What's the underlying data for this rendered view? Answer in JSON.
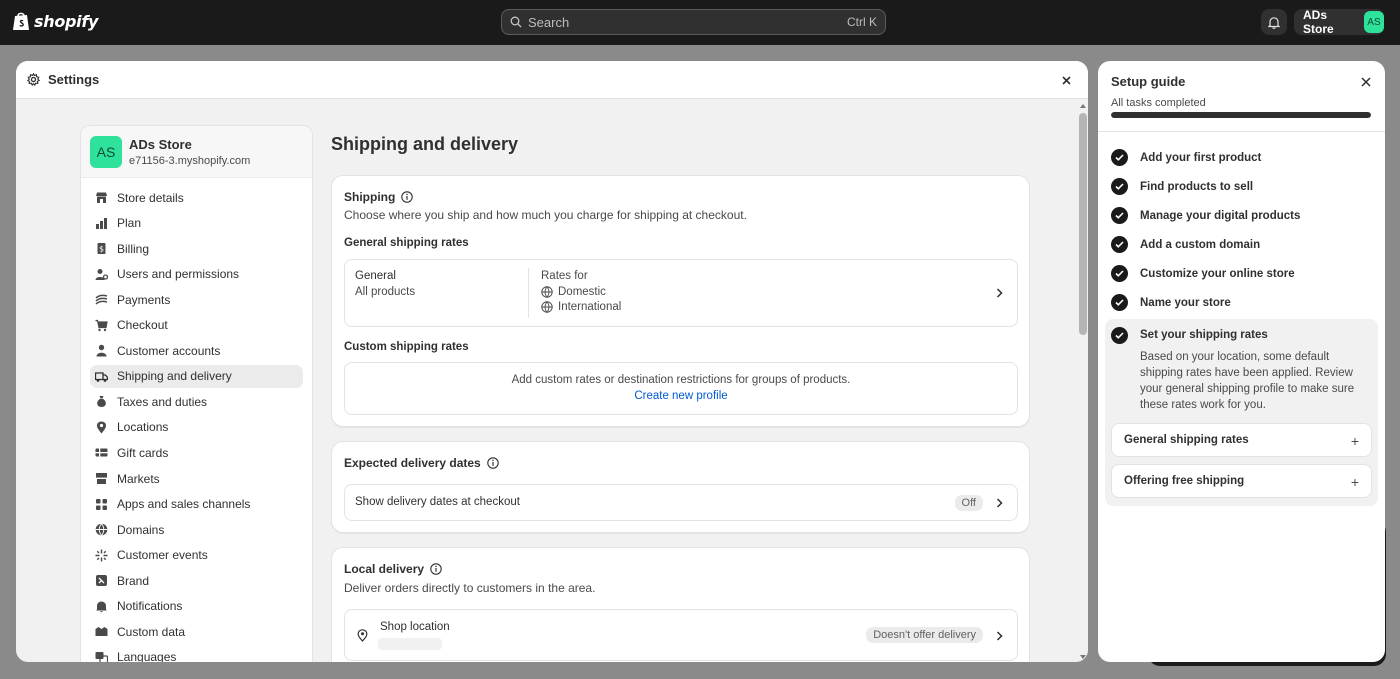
{
  "topbar": {
    "brand": "shopify",
    "search_placeholder": "Search",
    "search_shortcut": "Ctrl K",
    "store_label": "ADs Store",
    "store_initials": "AS"
  },
  "settings": {
    "title": "Settings",
    "store": {
      "initials": "AS",
      "name": "ADs Store",
      "domain": "e71156-3.myshopify.com"
    },
    "nav": [
      {
        "label": "Store details",
        "icon": "store-icon"
      },
      {
        "label": "Plan",
        "icon": "plan-chart-icon"
      },
      {
        "label": "Billing",
        "icon": "billing-icon"
      },
      {
        "label": "Users and permissions",
        "icon": "users-icon"
      },
      {
        "label": "Payments",
        "icon": "payments-icon"
      },
      {
        "label": "Checkout",
        "icon": "cart-icon"
      },
      {
        "label": "Customer accounts",
        "icon": "person-icon"
      },
      {
        "label": "Shipping and delivery",
        "icon": "truck-icon",
        "active": true
      },
      {
        "label": "Taxes and duties",
        "icon": "tax-bag-icon"
      },
      {
        "label": "Locations",
        "icon": "location-pin-icon"
      },
      {
        "label": "Gift cards",
        "icon": "gift-card-icon"
      },
      {
        "label": "Markets",
        "icon": "markets-icon"
      },
      {
        "label": "Apps and sales channels",
        "icon": "apps-icon"
      },
      {
        "label": "Domains",
        "icon": "globe-icon"
      },
      {
        "label": "Customer events",
        "icon": "sparkle-icon"
      },
      {
        "label": "Brand",
        "icon": "brand-icon"
      },
      {
        "label": "Notifications",
        "icon": "bell-icon"
      },
      {
        "label": "Custom data",
        "icon": "data-icon"
      },
      {
        "label": "Languages",
        "icon": "language-icon"
      }
    ],
    "page_title": "Shipping and delivery",
    "shipping": {
      "title": "Shipping",
      "description": "Choose where you ship and how much you charge for shipping at checkout.",
      "general_heading": "General shipping rates",
      "profile_name": "General",
      "profile_scope": "All products",
      "rates_for_label": "Rates for",
      "zones": [
        "Domestic",
        "International"
      ],
      "custom_heading": "Custom shipping rates",
      "custom_description": "Add custom rates or destination restrictions for groups of products.",
      "create_profile_link": "Create new profile"
    },
    "expected_delivery": {
      "title": "Expected delivery dates",
      "row_label": "Show delivery dates at checkout",
      "status": "Off"
    },
    "local_delivery": {
      "title": "Local delivery",
      "description": "Deliver orders directly to customers in the area.",
      "location_label": "Shop location",
      "status": "Doesn't offer delivery"
    }
  },
  "setup_guide": {
    "title": "Setup guide",
    "status": "All tasks completed",
    "progress_percent": 100,
    "tasks": [
      "Add your first product",
      "Find products to sell",
      "Manage your digital products",
      "Add a custom domain",
      "Customize your online store",
      "Name your store"
    ],
    "expanded_task": {
      "title": "Set your shipping rates",
      "description": "Based on your location, some default shipping rates have been applied. Review your general shipping profile to make sure these rates work for you.",
      "accordions": [
        "General shipping rates",
        "Offering free shipping"
      ]
    }
  }
}
